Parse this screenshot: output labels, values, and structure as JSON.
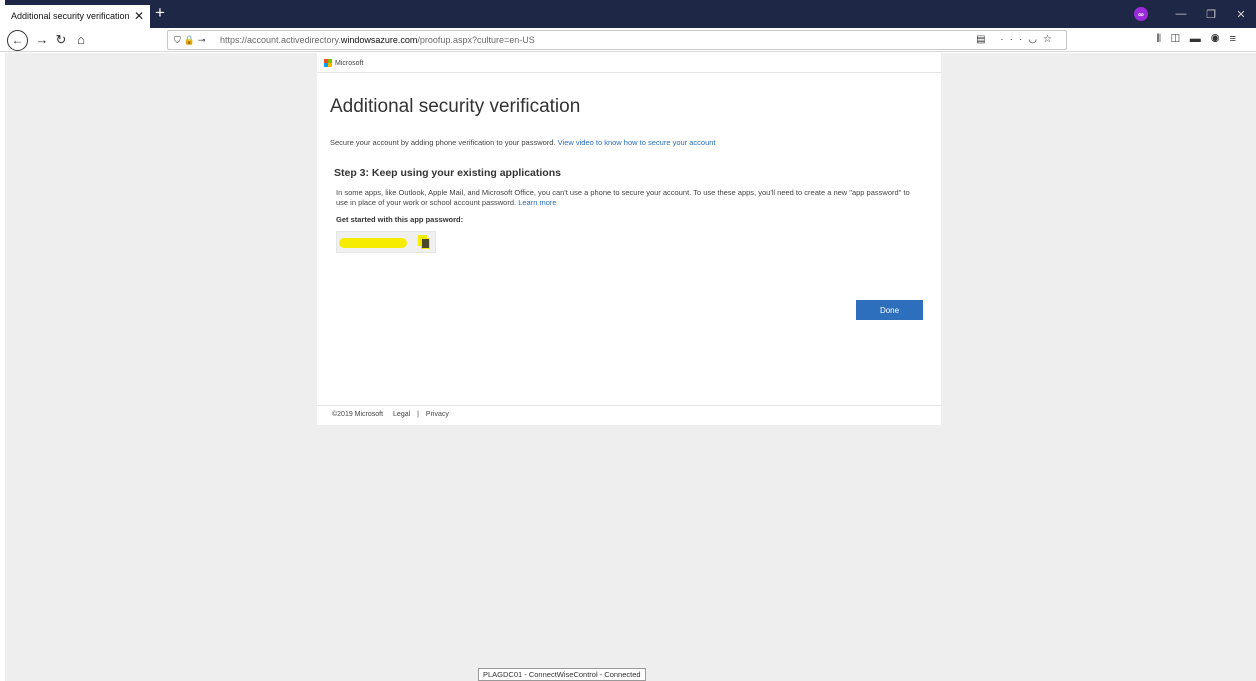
{
  "browser": {
    "tab_title": "Additional security verification",
    "tab_close": "✕",
    "new_tab": "+",
    "url_prefix": "https://account.activedirectory.",
    "url_domain": "windowsazure.com",
    "url_path": "/proofup.aspx?culture=en-US",
    "icons": [
      "back-icon",
      "forward-icon",
      "reload-icon",
      "home-icon",
      "shield-icon",
      "lock-icon",
      "key-icon",
      "reader-icon",
      "more-icon",
      "pocket-icon",
      "star-icon",
      "library-icon",
      "sidebar-icon",
      "extension-icon",
      "account-icon",
      "menu-icon",
      "private-mask-icon"
    ]
  },
  "page": {
    "brand": "Microsoft",
    "title": "Additional security verification",
    "intro_text": "Secure your account by adding phone verification to your password.",
    "intro_link": "View video to know how to secure your account",
    "step_heading": "Step 3: Keep using your existing applications",
    "step_desc": "In some apps, like Outlook, Apple Mail, and Microsoft Office, you can't use a phone to secure your account. To use these apps, you'll need to create a new \"app password\" to use in place of your work or school account password.",
    "learn_more": "Learn more",
    "get_started": "Get started with this app password:",
    "app_password": "",
    "done_label": "Done",
    "footer": {
      "copyright": "©2019 Microsoft",
      "legal": "Legal",
      "separator": "|",
      "privacy": "Privacy"
    }
  },
  "status_bar": "PLAGDC01 - ConnectWiseControl - Connected",
  "colors": {
    "tabstrip": "#1f2746",
    "button": "#2e6fbd",
    "link": "#2a6ebb",
    "redaction": "#f5ec00",
    "background": "#eeeeee"
  }
}
